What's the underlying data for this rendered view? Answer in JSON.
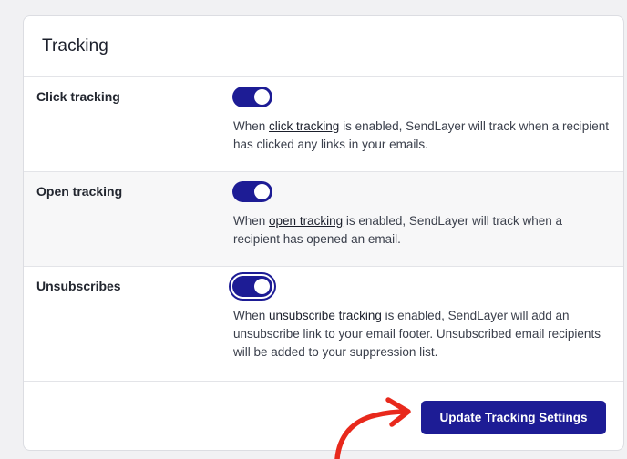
{
  "card": {
    "title": "Tracking"
  },
  "settings": [
    {
      "label": "Click tracking",
      "enabled": true,
      "desc_before": "When ",
      "link_text": "click tracking",
      "desc_after": " is enabled, SendLayer will track when a recipient has clicked any links in your emails."
    },
    {
      "label": "Open tracking",
      "enabled": true,
      "desc_before": "When ",
      "link_text": "open tracking",
      "desc_after": " is enabled, SendLayer will track when a recipient has opened an email."
    },
    {
      "label": "Unsubscribes",
      "enabled": true,
      "desc_before": "When ",
      "link_text": "unsubscribe tracking",
      "desc_after": " is enabled, SendLayer will add an unsubscribe link to your email footer. Unsubscribed email recipients will be added to your suppression list."
    }
  ],
  "footer": {
    "update_label": "Update Tracking Settings"
  },
  "colors": {
    "accent": "#1d1c95",
    "annotation_arrow": "#e8291c"
  },
  "icons": {
    "annotation": "red-curved-arrow-icon"
  }
}
